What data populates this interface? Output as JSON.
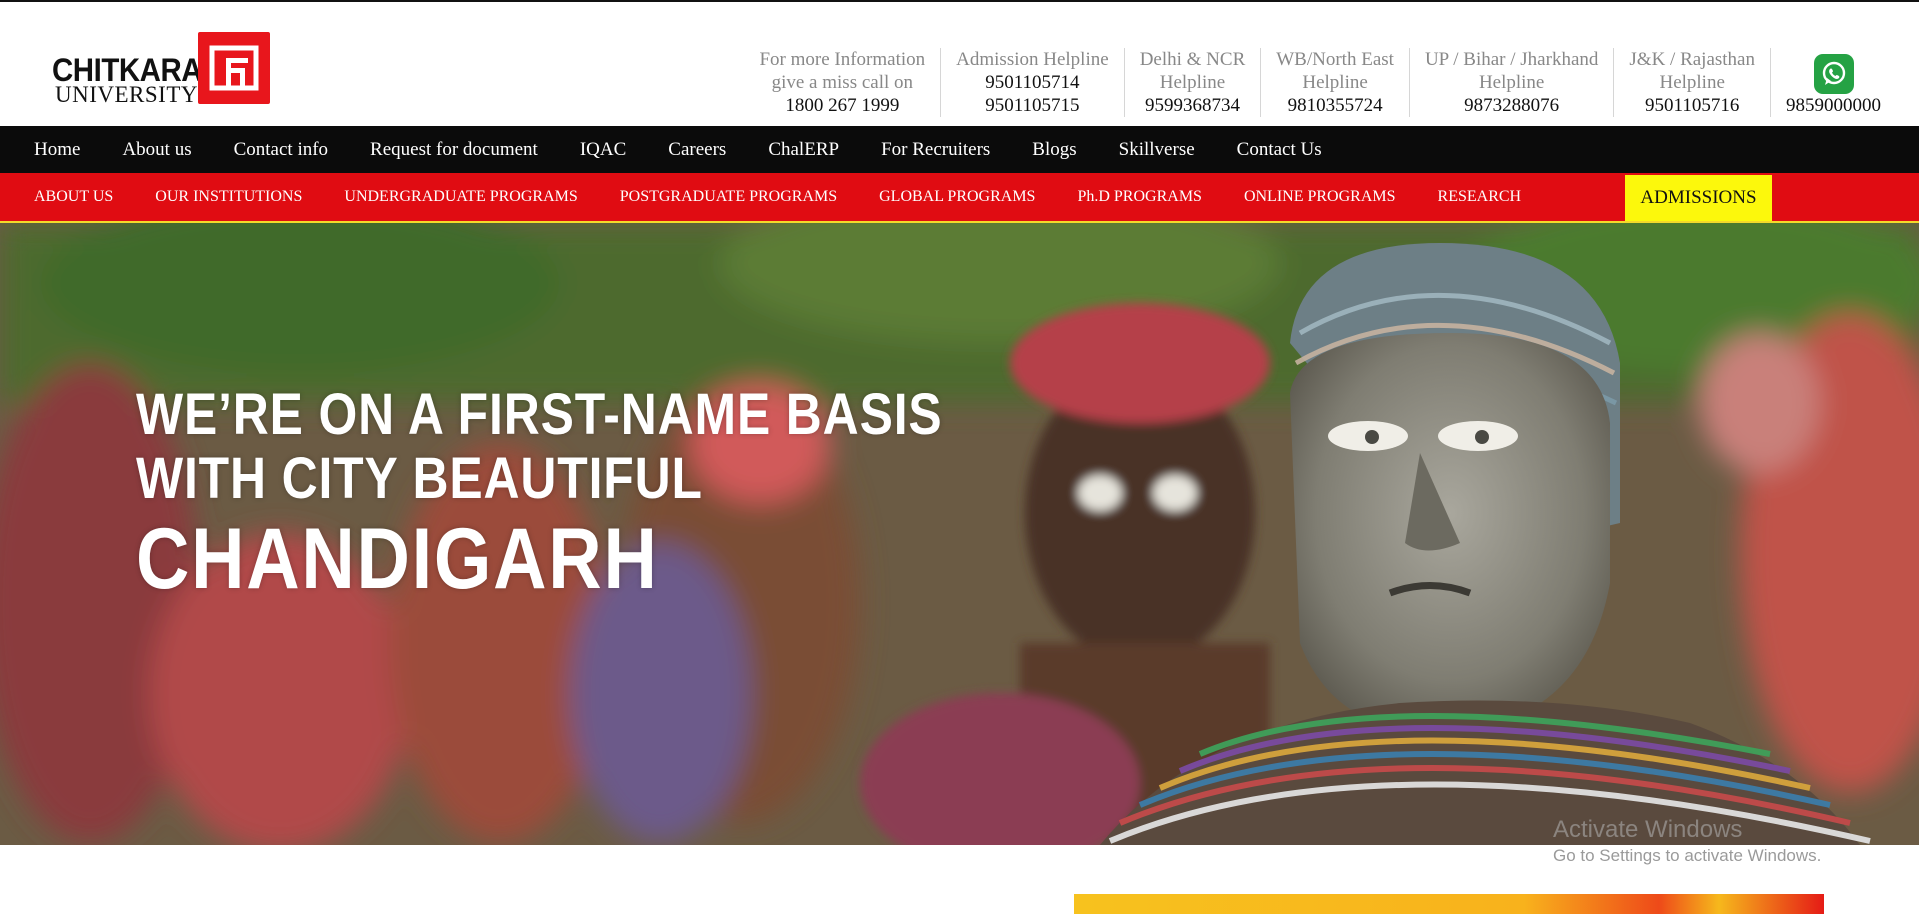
{
  "logo": {
    "word1": "CHITKARA",
    "word2": "UNIVERSITY"
  },
  "contacts": [
    {
      "label1": "For more Information",
      "label2": "give a miss call on",
      "number": "1800 267 1999"
    },
    {
      "label1": "Admission Helpline",
      "number": "9501105714",
      "number2": "9501105715"
    },
    {
      "label1": "Delhi & NCR",
      "label2": "Helpline",
      "number": "9599368734"
    },
    {
      "label1": "WB/North East",
      "label2": "Helpline",
      "number": "9810355724"
    },
    {
      "label1": "UP / Bihar / Jharkhand",
      "label2": "Helpline",
      "number": "9873288076"
    },
    {
      "label1": "J&K / Rajasthan",
      "label2": "Helpline",
      "number": "9501105716"
    },
    {
      "icon": "whatsapp-icon",
      "number": "9859000000"
    }
  ],
  "nav_primary": [
    "Home",
    "About us",
    "Contact info",
    "Request for document",
    "IQAC",
    "Careers",
    "ChalERP",
    "For Recruiters",
    "Blogs",
    "Skillverse",
    "Contact Us"
  ],
  "nav_secondary": [
    "ABOUT US",
    "OUR INSTITUTIONS",
    "UNDERGRADUATE PROGRAMS",
    "POSTGRADUATE PROGRAMS",
    "GLOBAL PROGRAMS",
    "Ph.D PROGRAMS",
    "ONLINE PROGRAMS",
    "RESEARCH"
  ],
  "admissions_label": "ADMISSIONS",
  "hero": {
    "line1": "WE’RE ON A FIRST-NAME BASIS",
    "line2": "WITH CITY BEAUTIFUL",
    "line3": "CHANDIGARH"
  },
  "watermark": {
    "line1": "Activate Windows",
    "line2": "Go to Settings to activate Windows."
  },
  "colors": {
    "nav_dark": "#0b0b0b",
    "nav_red": "#e00c12",
    "admissions_bg": "#fcf80c",
    "brand_red": "#e8161c",
    "whatsapp_green": "#25a244"
  }
}
